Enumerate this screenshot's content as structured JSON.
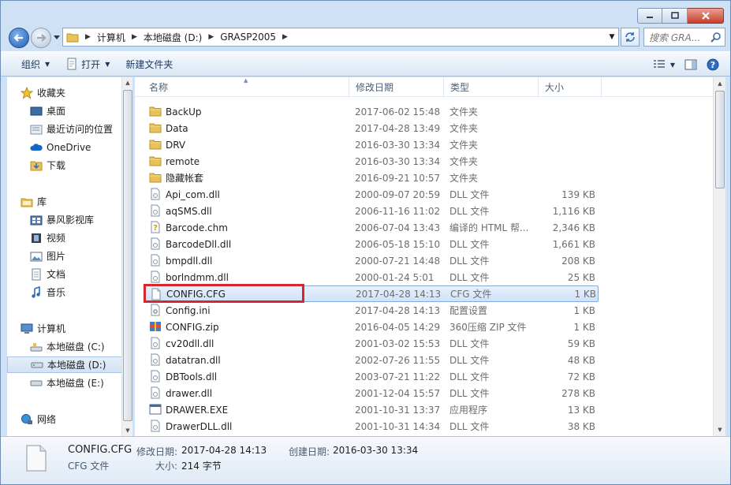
{
  "address": {
    "crumbs": [
      "计算机",
      "本地磁盘 (D:)",
      "GRASP2005"
    ]
  },
  "search": {
    "placeholder": "搜索 GRA..."
  },
  "toolbar": {
    "organize": "组织",
    "open": "打开",
    "new_folder": "新建文件夹"
  },
  "sidebar": {
    "favorites": "收藏夹",
    "desktop": "桌面",
    "recent": "最近访问的位置",
    "onedrive": "OneDrive",
    "downloads": "下载",
    "libraries": "库",
    "storm": "暴风影视库",
    "videos": "视频",
    "pictures": "图片",
    "documents": "文档",
    "music": "音乐",
    "computer": "计算机",
    "drive_c": "本地磁盘 (C:)",
    "drive_d": "本地磁盘 (D:)",
    "drive_e": "本地磁盘 (E:)",
    "network": "网络"
  },
  "columns": {
    "name": "名称",
    "date": "修改日期",
    "type": "类型",
    "size": "大小"
  },
  "files": [
    {
      "name": "BackUp",
      "date": "2017-06-02 15:48",
      "type": "文件夹",
      "size": "",
      "icon": "folder-icon"
    },
    {
      "name": "Data",
      "date": "2017-04-28 13:49",
      "type": "文件夹",
      "size": "",
      "icon": "folder-icon"
    },
    {
      "name": "DRV",
      "date": "2016-03-30 13:34",
      "type": "文件夹",
      "size": "",
      "icon": "folder-icon"
    },
    {
      "name": "remote",
      "date": "2016-03-30 13:34",
      "type": "文件夹",
      "size": "",
      "icon": "folder-icon"
    },
    {
      "name": "隐藏帐套",
      "date": "2016-09-21 10:57",
      "type": "文件夹",
      "size": "",
      "icon": "folder-icon"
    },
    {
      "name": "Api_com.dll",
      "date": "2000-09-07 20:59",
      "type": "DLL 文件",
      "size": "139 KB",
      "icon": "dll-file-icon"
    },
    {
      "name": "aqSMS.dll",
      "date": "2006-11-16 11:02",
      "type": "DLL 文件",
      "size": "1,116 KB",
      "icon": "dll-file-icon"
    },
    {
      "name": "Barcode.chm",
      "date": "2006-07-04 13:43",
      "type": "编译的 HTML 帮...",
      "size": "2,346 KB",
      "icon": "help-file-icon"
    },
    {
      "name": "BarcodeDll.dll",
      "date": "2006-05-18 15:10",
      "type": "DLL 文件",
      "size": "1,661 KB",
      "icon": "dll-file-icon"
    },
    {
      "name": "bmpdll.dll",
      "date": "2000-07-21 14:48",
      "type": "DLL 文件",
      "size": "208 KB",
      "icon": "dll-file-icon"
    },
    {
      "name": "borlndmm.dll",
      "date": "2000-01-24 5:01",
      "type": "DLL 文件",
      "size": "25 KB",
      "icon": "dll-file-icon"
    },
    {
      "name": "CONFIG.CFG",
      "date": "2017-04-28 14:13",
      "type": "CFG 文件",
      "size": "1 KB",
      "icon": "file-icon",
      "selected": true
    },
    {
      "name": "Config.ini",
      "date": "2017-04-28 14:13",
      "type": "配置设置",
      "size": "1 KB",
      "icon": "ini-file-icon"
    },
    {
      "name": "CONFIG.zip",
      "date": "2016-04-05 14:29",
      "type": "360压缩 ZIP 文件",
      "size": "1 KB",
      "icon": "zip-file-icon"
    },
    {
      "name": "cv20dll.dll",
      "date": "2001-03-02 15:53",
      "type": "DLL 文件",
      "size": "59 KB",
      "icon": "dll-file-icon"
    },
    {
      "name": "datatran.dll",
      "date": "2002-07-26 11:55",
      "type": "DLL 文件",
      "size": "48 KB",
      "icon": "dll-file-icon"
    },
    {
      "name": "DBTools.dll",
      "date": "2003-07-21 11:22",
      "type": "DLL 文件",
      "size": "72 KB",
      "icon": "dll-file-icon"
    },
    {
      "name": "drawer.dll",
      "date": "2001-12-04 15:57",
      "type": "DLL 文件",
      "size": "278 KB",
      "icon": "dll-file-icon"
    },
    {
      "name": "DRAWER.EXE",
      "date": "2001-10-31 13:37",
      "type": "应用程序",
      "size": "13 KB",
      "icon": "exe-file-icon"
    },
    {
      "name": "DrawerDLL.dll",
      "date": "2001-10-31 14:34",
      "type": "DLL 文件",
      "size": "38 KB",
      "icon": "dll-file-icon"
    }
  ],
  "details": {
    "name": "CONFIG.CFG",
    "type": "CFG 文件",
    "modified_label": "修改日期:",
    "modified_value": "2017-04-28 14:13",
    "created_label": "创建日期:",
    "created_value": "2016-03-30 13:34",
    "size_label": "大小:",
    "size_value": "214 字节"
  },
  "colors": {
    "selection": "#cfe2f8",
    "highlight_box": "#d6262e",
    "folder": "#e8c25a"
  }
}
